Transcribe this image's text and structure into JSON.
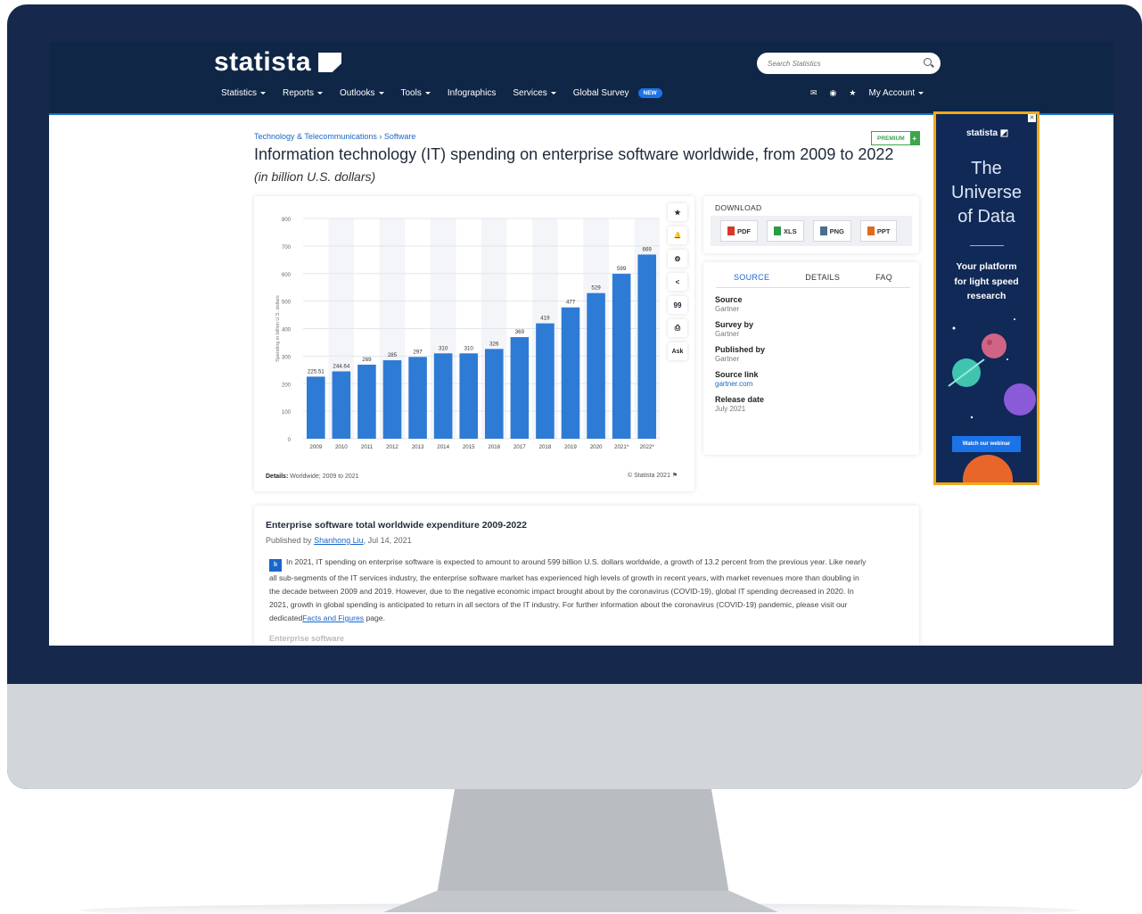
{
  "header": {
    "logo": "statista",
    "search_placeholder": "Search Statistics",
    "nav": [
      {
        "label": "Statistics",
        "caret": true
      },
      {
        "label": "Reports",
        "caret": true
      },
      {
        "label": "Outlooks",
        "caret": true
      },
      {
        "label": "Tools",
        "caret": true
      },
      {
        "label": "Infographics",
        "caret": false
      },
      {
        "label": "Services",
        "caret": true
      },
      {
        "label": "Global Survey",
        "caret": false
      }
    ],
    "new_badge": "NEW",
    "account_label": "My Account"
  },
  "breadcrumb": "Technology & Telecommunications › Software",
  "premium_label": "PREMIUM",
  "premium_plus": "+",
  "title": "Information technology (IT) spending on enterprise software worldwide, from 2009 to 2022",
  "subtitle": "(in billion U.S. dollars)",
  "chart_tools": {
    "star": "★",
    "bell": "🔔",
    "gear": "⚙",
    "share": "<",
    "quote": "99",
    "print": "⎙",
    "ask": "Ask"
  },
  "chart_data": {
    "type": "bar",
    "categories": [
      "2009",
      "2010",
      "2011",
      "2012",
      "2013",
      "2014",
      "2015",
      "2016",
      "2017",
      "2018",
      "2019",
      "2020",
      "2021*",
      "2022*"
    ],
    "values": [
      225.51,
      244.64,
      269,
      285,
      297,
      310,
      310,
      326,
      369,
      419,
      477,
      529,
      599,
      669
    ],
    "value_labels": [
      "225.51",
      "244.64",
      "269",
      "285",
      "297",
      "310",
      "310",
      "326",
      "369",
      "419",
      "477",
      "529",
      "599",
      "669"
    ],
    "ylabel": "Spending in billion U.S. dollars",
    "ylim": [
      0,
      800
    ],
    "yticks": [
      0,
      100,
      200,
      300,
      400,
      500,
      600,
      700,
      800
    ],
    "bar_color": "#2e7bd6",
    "grid": true
  },
  "chart_details": {
    "label": "Details:",
    "text": "Worldwide; 2009 to 2021"
  },
  "chart_credit": "© Statista 2021",
  "download": {
    "title": "DOWNLOAD",
    "buttons": [
      {
        "label": "PDF",
        "color": "#d9372b"
      },
      {
        "label": "XLS",
        "color": "#2e9a48"
      },
      {
        "label": "PNG",
        "color": "#4a6e8c"
      },
      {
        "label": "PPT",
        "color": "#e06a1e"
      }
    ]
  },
  "source_tabs": [
    "SOURCE",
    "DETAILS",
    "FAQ"
  ],
  "source_items": [
    {
      "label": "Source",
      "value": "Gartner"
    },
    {
      "label": "Survey by",
      "value": "Gartner"
    },
    {
      "label": "Published by",
      "value": "Gartner"
    },
    {
      "label": "Source link",
      "value": "gartner.com"
    },
    {
      "label": "Release date",
      "value": "July 2021"
    }
  ],
  "ad": {
    "logo": "statista",
    "headline_lines": [
      "The",
      "Universe",
      "of Data"
    ],
    "tagline_lines": [
      "Your platform",
      "for light speed",
      "research"
    ],
    "button": "Watch our webinar",
    "close": "✕"
  },
  "article": {
    "title": "Enterprise software total worldwide expenditure 2009-2022",
    "published_prefix": "Published by",
    "author": "Shanhong Liu",
    "date": ", Jul 14, 2021",
    "body_icon": "lı",
    "body": "In 2021, IT spending on enterprise software is expected to amount to around 599 billion U.S. dollars worldwide, a growth of 13.2 percent from the previous year. Like nearly all sub-segments of the IT services industry, the enterprise software market has experienced high levels of growth in recent years, with market revenues more than doubling in the decade between 2009 and 2019. However, due to the negative economic impact brought about by the coronavirus (COVID-19), global IT spending decreased in 2020. In 2021, growth in global spending is anticipated to return in all sectors of the IT industry. For further information about the coronavirus (COVID-19) pandemic, please visit our dedicated",
    "link": "Facts and Figures",
    "body_end": " page.",
    "fade_heading": "Enterprise software"
  }
}
